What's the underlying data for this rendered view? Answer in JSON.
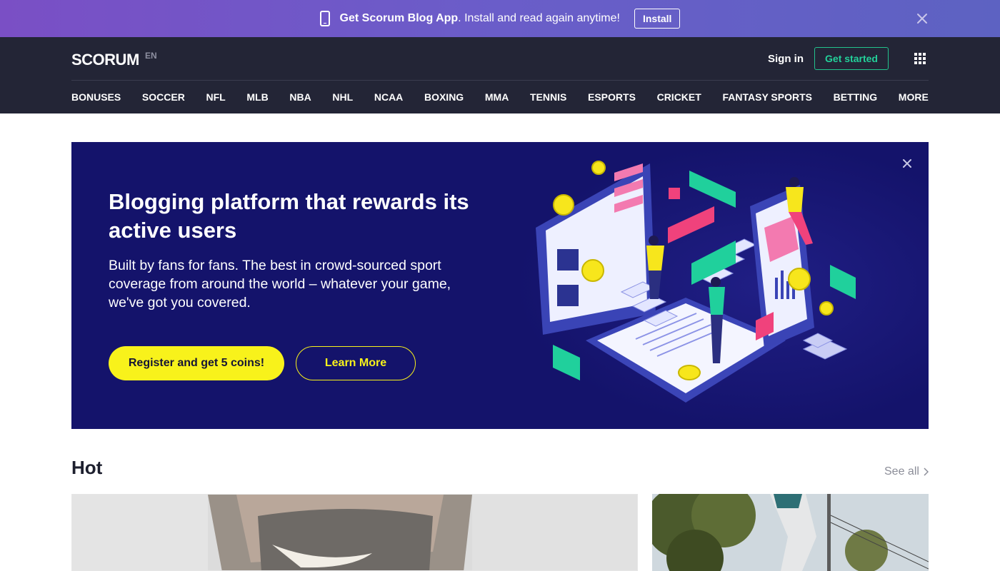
{
  "colors": {
    "banner_gradient_start": "#7a4fc5",
    "banner_gradient_end": "#5d62c2",
    "header_bg": "#232536",
    "accent_green": "#23d19a",
    "hero_bg": "#14136b",
    "accent_yellow": "#f8f21b"
  },
  "app_banner": {
    "app_name": "Get Scorum Blog App",
    "message": ". Install and read again anytime!",
    "install_label": "Install",
    "phone_icon": "phone-icon",
    "close_icon": "close-icon"
  },
  "header": {
    "logo": "SCORUM",
    "lang": "EN",
    "signin_label": "Sign in",
    "getstarted_label": "Get started",
    "apps_icon": "grid-icon",
    "nav": [
      "BONUSES",
      "SOCCER",
      "NFL",
      "MLB",
      "NBA",
      "NHL",
      "NCAA",
      "BOXING",
      "MMA",
      "TENNIS",
      "ESPORTS",
      "CRICKET",
      "FANTASY SPORTS",
      "BETTING",
      "MORE"
    ]
  },
  "hero": {
    "title": "Blogging platform that rewards its active users",
    "subtitle": "Built by fans for fans. The best in crowd-sourced sport coverage from around the world – whatever your game, we've got you covered.",
    "register_label": "Register and get 5 coins!",
    "learn_label": "Learn More",
    "close_icon": "close-icon"
  },
  "hot": {
    "title": "Hot",
    "see_all_label": "See all",
    "chevron_icon": "chevron-right-icon"
  }
}
